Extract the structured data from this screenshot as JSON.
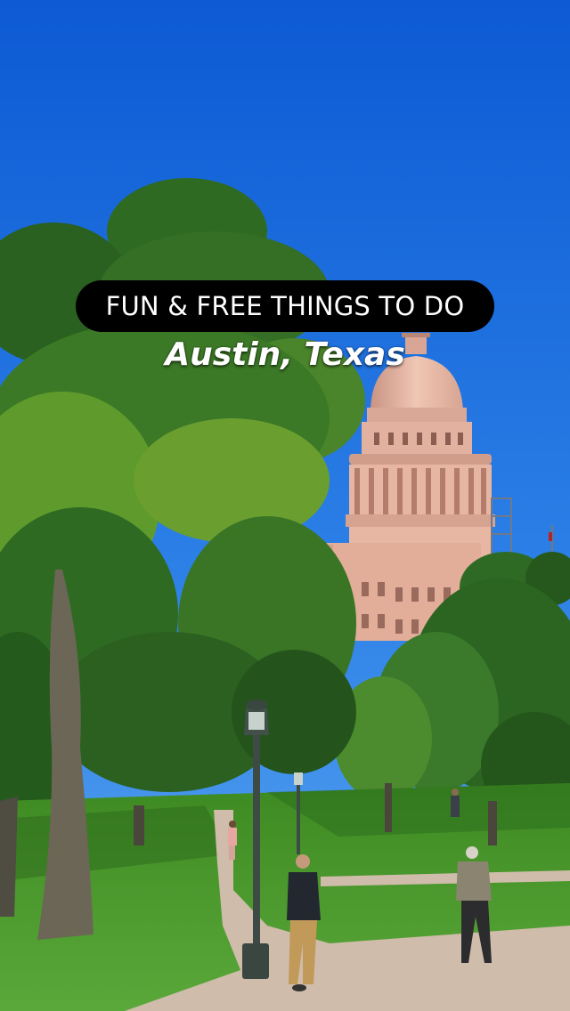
{
  "overlay": {
    "headline": "FUN & FREE THINGS TO DO",
    "location": "Austin, Texas"
  },
  "colors": {
    "sky_top": "#0f5fd6",
    "sky_bottom": "#3f93ee",
    "capitol": "#e8b7a3",
    "lawn": "#4d9a2c",
    "path": "#cdb9a6",
    "foliage_dark": "#24501c",
    "foliage_light": "#6e9f2e",
    "pill": "#000000",
    "text": "#ffffff"
  }
}
